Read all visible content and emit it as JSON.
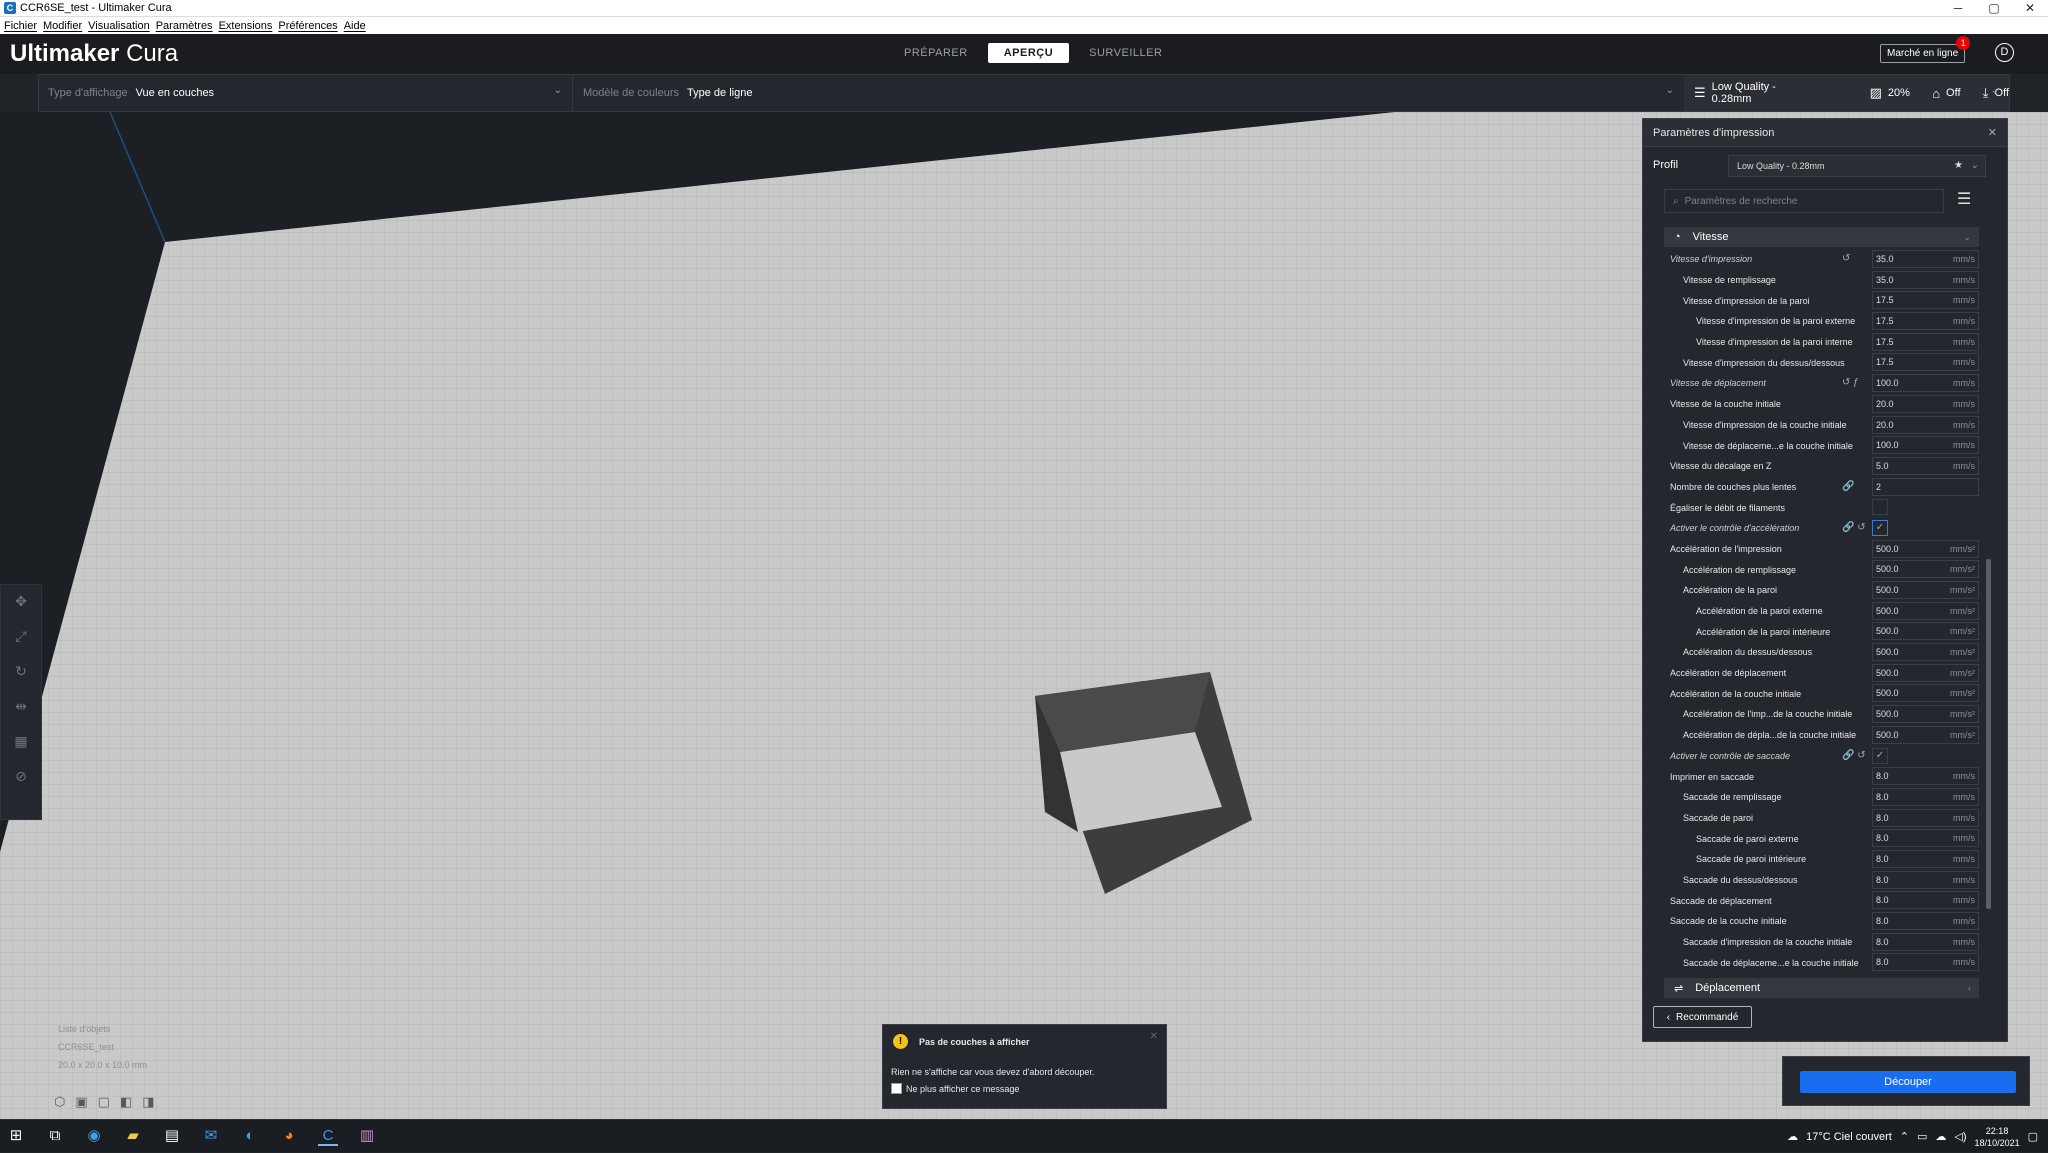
{
  "window": {
    "title": "CCR6SE_test - Ultimaker Cura",
    "controls": [
      "─",
      "▢",
      "✕"
    ]
  },
  "menu": [
    "Fichier",
    "Modifier",
    "Visualisation",
    "Paramètres",
    "Extensions",
    "Préférences",
    "Aide"
  ],
  "header": {
    "logo_bold": "Ultimaker",
    "logo_light": "Cura",
    "stages": [
      "PRÉPARER",
      "APERÇU",
      "SURVEILLER"
    ],
    "marketplace": "Marché en ligne",
    "marketplace_badge": "1",
    "account_initial": "D"
  },
  "viewbar": {
    "type_label": "Type d'affichage",
    "type_value": "Vue en couches",
    "color_label": "Modèle de couleurs",
    "color_value": "Type de ligne"
  },
  "printsel": {
    "profile": "Low Quality - 0.28mm",
    "infill": "20%",
    "support": "Off",
    "adhesion": "Off"
  },
  "settings": {
    "title": "Paramètres d'impression",
    "profile_label": "Profil",
    "profile_value": "Low Quality - 0.28mm",
    "search_placeholder": "Paramètres de recherche",
    "cat_speed": "Vitesse",
    "cat_travel": "Déplacement",
    "recommended": "Recommandé",
    "rows": [
      {
        "name": "Vitesse d'impression",
        "value": "35.0",
        "unit": "mm/s",
        "indent": 0,
        "italic": true,
        "icons": "↺"
      },
      {
        "name": "Vitesse de remplissage",
        "value": "35.0",
        "unit": "mm/s",
        "indent": 1
      },
      {
        "name": "Vitesse d'impression de la paroi",
        "value": "17.5",
        "unit": "mm/s",
        "indent": 1
      },
      {
        "name": "Vitesse d'impression de la paroi externe",
        "value": "17.5",
        "unit": "mm/s",
        "indent": 2
      },
      {
        "name": "Vitesse d'impression de la paroi interne",
        "value": "17.5",
        "unit": "mm/s",
        "indent": 2
      },
      {
        "name": "Vitesse d'impression du dessus/dessous",
        "value": "17.5",
        "unit": "mm/s",
        "indent": 1
      },
      {
        "name": "Vitesse de déplacement",
        "value": "100.0",
        "unit": "mm/s",
        "indent": 0,
        "italic": true,
        "icons": "↺ ƒ"
      },
      {
        "name": "Vitesse de la couche initiale",
        "value": "20.0",
        "unit": "mm/s",
        "indent": 0
      },
      {
        "name": "Vitesse d'impression de la couche initiale",
        "value": "20.0",
        "unit": "mm/s",
        "indent": 1
      },
      {
        "name": "Vitesse de déplaceme...e la couche initiale",
        "value": "100.0",
        "unit": "mm/s",
        "indent": 1
      },
      {
        "name": "Vitesse du décalage en Z",
        "value": "5.0",
        "unit": "mm/s",
        "indent": 0
      },
      {
        "name": "Nombre de couches plus lentes",
        "value": "2",
        "unit": "",
        "indent": 0,
        "icons": "🔗"
      },
      {
        "name": "Égaliser le débit de filaments",
        "check": "",
        "indent": 0
      },
      {
        "name": "Activer le contrôle d'accélération",
        "check": "✓",
        "checkon": true,
        "indent": 0,
        "italic": true,
        "icons": "🔗 ↺"
      },
      {
        "name": "Accélération de l'impression",
        "value": "500.0",
        "unit": "mm/s²",
        "indent": 0
      },
      {
        "name": "Accélération de remplissage",
        "value": "500.0",
        "unit": "mm/s²",
        "indent": 1
      },
      {
        "name": "Accélération de la paroi",
        "value": "500.0",
        "unit": "mm/s²",
        "indent": 1
      },
      {
        "name": "Accélération de la paroi externe",
        "value": "500.0",
        "unit": "mm/s²",
        "indent": 2
      },
      {
        "name": "Accélération de la paroi intérieure",
        "value": "500.0",
        "unit": "mm/s²",
        "indent": 2
      },
      {
        "name": "Accélération du dessus/dessous",
        "value": "500.0",
        "unit": "mm/s²",
        "indent": 1
      },
      {
        "name": "Accélération de déplacement",
        "value": "500.0",
        "unit": "mm/s²",
        "indent": 0
      },
      {
        "name": "Accélération de la couche initiale",
        "value": "500.0",
        "unit": "mm/s²",
        "indent": 0
      },
      {
        "name": "Accélération de l'imp...de la couche initiale",
        "value": "500.0",
        "unit": "mm/s²",
        "indent": 1
      },
      {
        "name": "Accélération de dépla...de la couche initiale",
        "value": "500.0",
        "unit": "mm/s²",
        "indent": 1
      },
      {
        "name": "Activer le contrôle de saccade",
        "check": "✓",
        "indent": 0,
        "italic": true,
        "icons": "🔗 ↺"
      },
      {
        "name": "Imprimer en saccade",
        "value": "8.0",
        "unit": "mm/s",
        "indent": 0
      },
      {
        "name": "Saccade de remplissage",
        "value": "8.0",
        "unit": "mm/s",
        "indent": 1
      },
      {
        "name": "Saccade de paroi",
        "value": "8.0",
        "unit": "mm/s",
        "indent": 1
      },
      {
        "name": "Saccade de paroi externe",
        "value": "8.0",
        "unit": "mm/s",
        "indent": 2
      },
      {
        "name": "Saccade de paroi intérieure",
        "value": "8.0",
        "unit": "mm/s",
        "indent": 2
      },
      {
        "name": "Saccade du dessus/dessous",
        "value": "8.0",
        "unit": "mm/s",
        "indent": 1
      },
      {
        "name": "Saccade de déplacement",
        "value": "8.0",
        "unit": "mm/s",
        "indent": 0
      },
      {
        "name": "Saccade de la couche initiale",
        "value": "8.0",
        "unit": "mm/s",
        "indent": 0
      },
      {
        "name": "Saccade d'impression de la couche initiale",
        "value": "8.0",
        "unit": "mm/s",
        "indent": 1
      },
      {
        "name": "Saccade de déplaceme...e la couche initiale",
        "value": "8.0",
        "unit": "mm/s",
        "indent": 1
      }
    ]
  },
  "objects": {
    "title": "Liste d'objets",
    "name": "CCR6SE_test",
    "dims": "20.0 x 20.0 x 10.0 mm"
  },
  "slice": {
    "label": "Découper"
  },
  "message": {
    "title": "Pas de couches à afficher",
    "text": "Rien ne s'affiche car vous devez d'abord découper.",
    "checkbox": "Ne plus afficher ce message"
  },
  "taskbar": {
    "weather": "17°C  Ciel couvert",
    "time": "22:18",
    "date": "18/10/2021"
  }
}
